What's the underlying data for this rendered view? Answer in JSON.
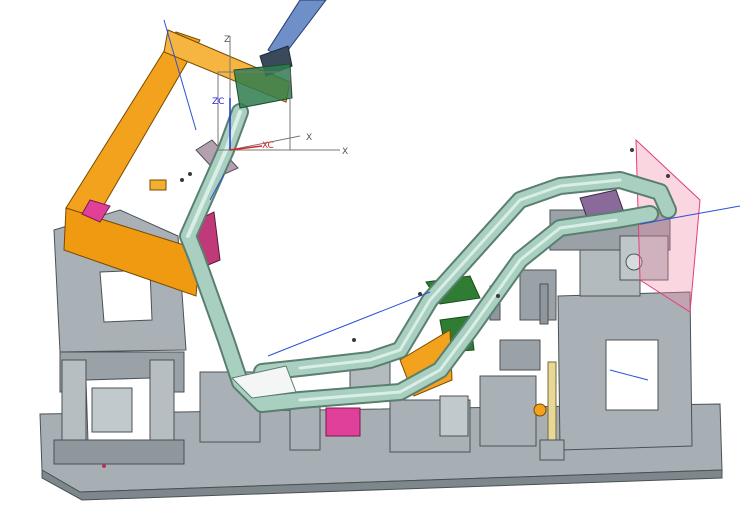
{
  "viewport": {
    "colors": {
      "background": "#ffffff",
      "fixture_gray": "#a9b1b6",
      "fixture_gray_dark": "#6f777c",
      "tube": "#a9cfc0",
      "tube_dark": "#6f9f8c",
      "orange": "#f2a21c",
      "magenta": "#e0409a",
      "pink_plane": "#f08aa8",
      "blue_line": "#2a52d8",
      "green_part": "#2e7d32",
      "cylinder_blue": "#6f8fc8"
    },
    "triad": {
      "z_label": "Z",
      "zc_label": "ZC",
      "x_label": "X",
      "xc_label": "XC",
      "x2_label": "X"
    }
  }
}
